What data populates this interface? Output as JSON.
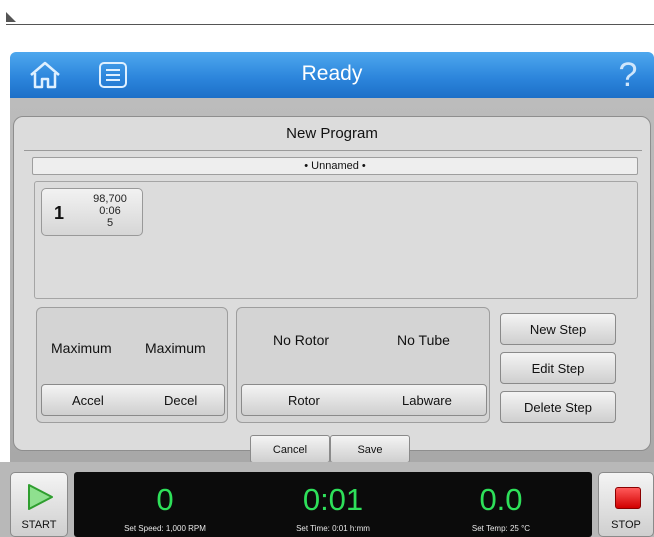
{
  "header": {
    "title": "Ready",
    "home_icon": "home-icon",
    "list_icon": "list-icon",
    "help_icon": "help-icon",
    "help_glyph": "?"
  },
  "program": {
    "title": "New Program",
    "name": "• Unnamed •",
    "steps": [
      {
        "number": "1",
        "speed": "98,700",
        "time": "0:06",
        "temp": "5"
      }
    ]
  },
  "settings": {
    "accel_value": "Maximum",
    "decel_value": "Maximum",
    "accel_label": "Accel",
    "decel_label": "Decel",
    "rotor_value": "No Rotor",
    "tube_value": "No Tube",
    "rotor_label": "Rotor",
    "labware_label": "Labware"
  },
  "step_actions": {
    "new_step": "New Step",
    "edit_step": "Edit Step",
    "delete_step": "Delete Step"
  },
  "dialog_actions": {
    "cancel": "Cancel",
    "save": "Save"
  },
  "status": {
    "start_label": "START",
    "stop_label": "STOP",
    "speed_value": "0",
    "speed_label": "Set Speed: 1,000 RPM",
    "time_value": "0:01",
    "time_label": "Set Time: 0:01 h:mm",
    "temp_value": "0.0",
    "temp_label": "Set Temp: 25 °C"
  },
  "colors": {
    "titlebar": "#2d86dc",
    "readout_green": "#2ee05a",
    "stop_red": "#d10000",
    "start_green": "#3bbf3b"
  }
}
